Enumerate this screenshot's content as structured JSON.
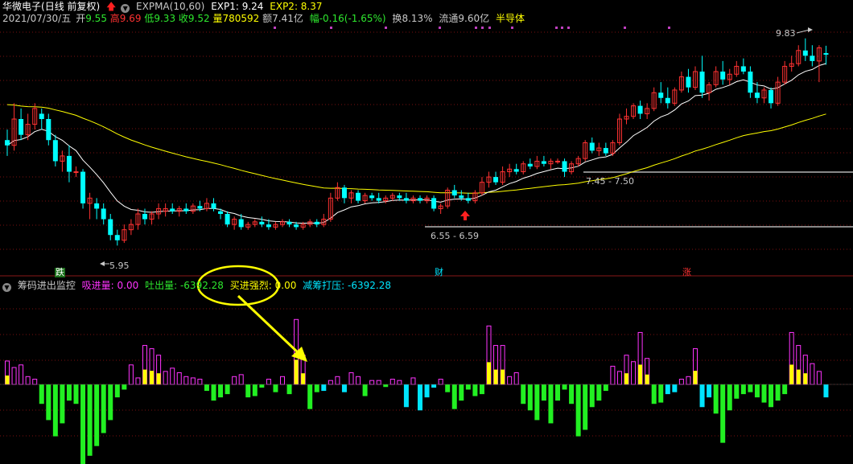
{
  "header": {
    "stock_name": "华微电子",
    "period": "(日线 前复权)",
    "indicator_name": "EXPMA(10,60)",
    "exp1": "EXP1: 9.24",
    "exp2": "EXP2: 8.37",
    "colors": {
      "stock": "#ffffff",
      "exp1": "#ffffff",
      "exp2": "#ffff00",
      "up": "#ff3232",
      "down": "#00ffff",
      "green": "#2ee82e"
    }
  },
  "quote": {
    "date": "2021/07/30/五",
    "open_label": "开",
    "open": "9.55",
    "high_label": "高",
    "high": "9.69",
    "low_label": "低",
    "low": "9.33",
    "close_label": "收",
    "close": "9.52",
    "volume_label": "量",
    "volume": "780592",
    "amount_label": "额",
    "amount": "7.41亿",
    "change_label": "幅",
    "change": "-0.16(-1.65%)",
    "turnover_label": "换",
    "turnover": "8.13%",
    "float_label": "流通",
    "float": "9.60亿",
    "sector": "半导体"
  },
  "price_labels": {
    "max": "9.83",
    "min": "5.95",
    "range1": "7.45 - 7.50",
    "range2": "6.55 - 6.59"
  },
  "events": {
    "fall": "跌",
    "finance": "财",
    "rise": "涨"
  },
  "indicator": {
    "name": "筹码进出监控",
    "absorb_label": "吸进量:",
    "absorb": "0.00",
    "spit_label": "吐出量:",
    "spit": "-6392.28",
    "strong_buy_label": "买进强烈:",
    "strong_buy": "0.00",
    "reduce_label": "减筹打压:",
    "reduce": "-6392.28"
  },
  "chart_data": {
    "type": "candlestick",
    "price_ylim": [
      5.6,
      10.1
    ],
    "candles": [
      [
        7.9,
        8.1,
        7.6,
        7.8
      ],
      [
        7.8,
        8.6,
        7.7,
        8.3
      ],
      [
        8.3,
        8.5,
        7.9,
        8.0
      ],
      [
        8.0,
        8.4,
        7.9,
        8.2
      ],
      [
        8.2,
        8.6,
        8.1,
        8.5
      ],
      [
        8.4,
        8.5,
        8.1,
        8.3
      ],
      [
        8.3,
        8.4,
        7.8,
        7.9
      ],
      [
        7.9,
        8.0,
        7.4,
        7.5
      ],
      [
        7.5,
        7.7,
        7.3,
        7.6
      ],
      [
        7.6,
        7.8,
        7.1,
        7.3
      ],
      [
        7.3,
        7.4,
        7.2,
        7.3
      ],
      [
        7.3,
        7.35,
        6.6,
        6.7
      ],
      [
        6.7,
        6.9,
        6.4,
        6.8
      ],
      [
        6.7,
        6.8,
        6.4,
        6.6
      ],
      [
        6.6,
        6.7,
        6.3,
        6.4
      ],
      [
        6.4,
        6.5,
        6.0,
        6.1
      ],
      [
        6.1,
        6.2,
        5.9,
        6.0
      ],
      [
        6.0,
        6.3,
        5.95,
        6.2
      ],
      [
        6.2,
        6.4,
        6.1,
        6.3
      ],
      [
        6.3,
        6.6,
        6.2,
        6.5
      ],
      [
        6.5,
        6.6,
        6.3,
        6.4
      ],
      [
        6.4,
        6.55,
        6.3,
        6.5
      ],
      [
        6.5,
        6.7,
        6.4,
        6.6
      ],
      [
        6.55,
        6.7,
        6.45,
        6.6
      ],
      [
        6.6,
        6.7,
        6.5,
        6.55
      ],
      [
        6.55,
        6.65,
        6.45,
        6.6
      ],
      [
        6.6,
        6.7,
        6.5,
        6.55
      ],
      [
        6.55,
        6.7,
        6.5,
        6.65
      ],
      [
        6.65,
        6.75,
        6.55,
        6.6
      ],
      [
        6.6,
        6.8,
        6.55,
        6.7
      ],
      [
        6.7,
        6.8,
        6.55,
        6.6
      ],
      [
        6.55,
        6.6,
        6.4,
        6.5
      ],
      [
        6.5,
        6.55,
        6.25,
        6.3
      ],
      [
        6.3,
        6.45,
        6.2,
        6.4
      ],
      [
        6.4,
        6.5,
        6.2,
        6.25
      ],
      [
        6.25,
        6.35,
        6.2,
        6.3
      ],
      [
        6.3,
        6.4,
        6.25,
        6.35
      ],
      [
        6.35,
        6.45,
        6.25,
        6.3
      ],
      [
        6.3,
        6.4,
        6.2,
        6.25
      ],
      [
        6.25,
        6.35,
        6.2,
        6.3
      ],
      [
        6.3,
        6.4,
        6.25,
        6.35
      ],
      [
        6.35,
        6.4,
        6.25,
        6.3
      ],
      [
        6.3,
        6.35,
        6.2,
        6.25
      ],
      [
        6.25,
        6.35,
        6.2,
        6.3
      ],
      [
        6.3,
        6.4,
        6.25,
        6.35
      ],
      [
        6.35,
        6.4,
        6.25,
        6.3
      ],
      [
        6.3,
        6.5,
        6.25,
        6.4
      ],
      [
        6.4,
        6.9,
        6.35,
        6.8
      ],
      [
        6.8,
        7.1,
        6.75,
        7.0
      ],
      [
        7.0,
        7.05,
        6.7,
        6.8
      ],
      [
        6.8,
        6.95,
        6.7,
        6.9
      ],
      [
        6.9,
        6.95,
        6.7,
        6.75
      ],
      [
        6.75,
        6.9,
        6.7,
        6.85
      ],
      [
        6.85,
        6.9,
        6.75,
        6.8
      ],
      [
        6.8,
        6.9,
        6.7,
        6.75
      ],
      [
        6.75,
        6.85,
        6.7,
        6.8
      ],
      [
        6.8,
        6.9,
        6.75,
        6.85
      ],
      [
        6.85,
        6.9,
        6.75,
        6.8
      ],
      [
        6.8,
        6.9,
        6.7,
        6.75
      ],
      [
        6.75,
        6.85,
        6.7,
        6.8
      ],
      [
        6.8,
        6.85,
        6.7,
        6.75
      ],
      [
        6.75,
        6.85,
        6.7,
        6.8
      ],
      [
        6.8,
        6.85,
        6.55,
        6.6
      ],
      [
        6.6,
        6.7,
        6.5,
        6.65
      ],
      [
        6.65,
        7.0,
        6.6,
        6.95
      ],
      [
        6.95,
        7.05,
        6.8,
        6.85
      ],
      [
        6.85,
        6.95,
        6.75,
        6.8
      ],
      [
        6.8,
        6.9,
        6.7,
        6.75
      ],
      [
        6.75,
        6.95,
        6.7,
        6.9
      ],
      [
        6.9,
        7.2,
        6.85,
        7.1
      ],
      [
        7.1,
        7.3,
        7.0,
        7.2
      ],
      [
        7.2,
        7.3,
        7.05,
        7.1
      ],
      [
        7.1,
        7.4,
        7.05,
        7.3
      ],
      [
        7.3,
        7.45,
        7.2,
        7.35
      ],
      [
        7.35,
        7.45,
        7.25,
        7.3
      ],
      [
        7.3,
        7.5,
        7.25,
        7.45
      ],
      [
        7.45,
        7.55,
        7.35,
        7.4
      ],
      [
        7.4,
        7.6,
        7.35,
        7.5
      ],
      [
        7.5,
        7.6,
        7.4,
        7.45
      ],
      [
        7.45,
        7.55,
        7.35,
        7.5
      ],
      [
        7.5,
        7.55,
        7.45,
        7.5
      ],
      [
        7.5,
        7.55,
        7.2,
        7.3
      ],
      [
        7.3,
        7.5,
        7.25,
        7.45
      ],
      [
        7.45,
        7.6,
        7.4,
        7.55
      ],
      [
        7.55,
        7.9,
        7.5,
        7.85
      ],
      [
        7.85,
        7.95,
        7.65,
        7.7
      ],
      [
        7.7,
        7.85,
        7.6,
        7.75
      ],
      [
        7.75,
        7.85,
        7.6,
        7.65
      ],
      [
        7.65,
        7.9,
        7.6,
        7.85
      ],
      [
        7.85,
        8.4,
        7.8,
        8.3
      ],
      [
        8.3,
        8.5,
        8.2,
        8.35
      ],
      [
        8.35,
        8.6,
        8.3,
        8.55
      ],
      [
        8.55,
        8.65,
        8.3,
        8.4
      ],
      [
        8.4,
        8.6,
        8.3,
        8.5
      ],
      [
        8.5,
        8.9,
        8.45,
        8.8
      ],
      [
        8.8,
        9.0,
        8.6,
        8.7
      ],
      [
        8.7,
        8.9,
        8.5,
        8.6
      ],
      [
        8.6,
        8.9,
        8.55,
        8.85
      ],
      [
        8.85,
        9.2,
        8.8,
        9.1
      ],
      [
        9.1,
        9.25,
        8.8,
        8.9
      ],
      [
        8.9,
        9.3,
        8.85,
        9.2
      ],
      [
        9.2,
        9.5,
        8.7,
        8.8
      ],
      [
        8.8,
        9.0,
        8.65,
        8.95
      ],
      [
        8.95,
        9.3,
        8.9,
        9.2
      ],
      [
        9.2,
        9.4,
        8.95,
        9.05
      ],
      [
        9.05,
        9.25,
        8.95,
        9.15
      ],
      [
        9.15,
        9.4,
        9.1,
        9.3
      ],
      [
        9.3,
        9.45,
        9.15,
        9.2
      ],
      [
        9.2,
        9.3,
        8.7,
        8.8
      ],
      [
        8.8,
        9.0,
        8.6,
        8.7
      ],
      [
        8.7,
        8.9,
        8.6,
        8.85
      ],
      [
        8.85,
        8.9,
        8.5,
        8.6
      ],
      [
        8.6,
        9.1,
        8.55,
        9.0
      ],
      [
        9.0,
        9.4,
        8.95,
        9.3
      ],
      [
        9.3,
        9.5,
        9.2,
        9.35
      ],
      [
        9.35,
        9.7,
        9.3,
        9.6
      ],
      [
        9.6,
        9.83,
        9.4,
        9.5
      ],
      [
        9.5,
        9.7,
        9.3,
        9.4
      ],
      [
        9.4,
        9.7,
        9.0,
        9.65
      ],
      [
        9.55,
        9.69,
        9.33,
        9.52
      ]
    ],
    "indicator_ylim": [
      -140,
      140
    ],
    "indicator_bars": [
      36,
      26,
      30,
      12,
      8,
      -30,
      -55,
      -80,
      -60,
      -25,
      -30,
      -140,
      -110,
      -95,
      -75,
      -55,
      -20,
      -8,
      30,
      10,
      60,
      55,
      45,
      20,
      25,
      18,
      12,
      10,
      8,
      -10,
      -25,
      -20,
      -15,
      12,
      15,
      -20,
      -18,
      -5,
      8,
      -12,
      12,
      -15,
      100,
      45,
      -38,
      -12,
      -10,
      6,
      12,
      -12,
      18,
      12,
      -18,
      6,
      6,
      -4,
      8,
      6,
      -35,
      10,
      -40,
      -20,
      -5,
      8,
      -12,
      -38,
      -25,
      -8,
      -18,
      -15,
      90,
      60,
      60,
      12,
      18,
      -30,
      -40,
      -55,
      -25,
      -60,
      -25,
      -8,
      -30,
      -80,
      -70,
      -35,
      -25,
      -10,
      28,
      20,
      45,
      35,
      80,
      40,
      -30,
      -28,
      -15,
      -12,
      8,
      12,
      55,
      -35,
      -20,
      -45,
      -90,
      -40,
      -22,
      -15,
      -12,
      -20,
      -28,
      -35,
      -25,
      -15,
      80,
      60,
      45,
      32,
      20,
      -20
    ]
  }
}
